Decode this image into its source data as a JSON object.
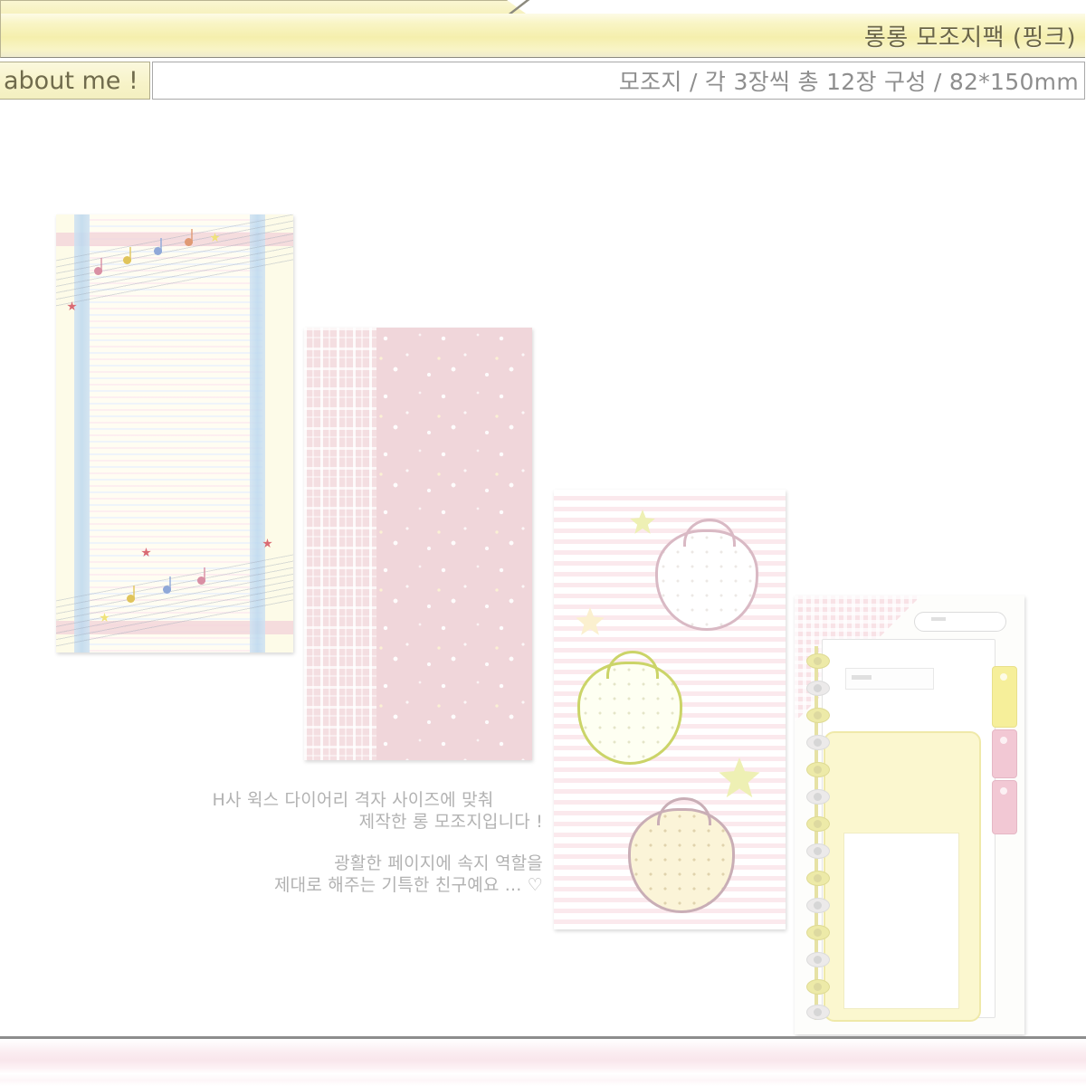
{
  "header": {
    "tab_label": "",
    "product_title": "롱롱 모조지팩 (핑크)",
    "about_label": "about me !",
    "spec_text": "모조지 / 각 3장씩 총 12장 구성 / 82*150mm"
  },
  "gallery": {
    "photos": [
      {
        "name": "music-note-lined-paper",
        "description": "크림색 줄지 + 하늘색 세로줄 + 음표 장식"
      },
      {
        "name": "pink-dotted-plaid-paper",
        "description": "핑크 도트 + 좌측 체크 무늬"
      },
      {
        "name": "strawberry-star-paper",
        "description": "핑크 가로줄 + 딸기 3개 + 별 3개"
      },
      {
        "name": "disc-bound-planner",
        "description": "디스크 바인더 다이어리 + 인덱스 탭"
      }
    ]
  },
  "caption": {
    "block1_line1": "H사 윅스 다이어리 격자 사이즈에 맞춰",
    "block1_line2": "제작한 롱 모조지입니다 !",
    "block2_line1": "광활한 페이지에 속지 역할을",
    "block2_line2": "제대로 해주는 기특한 친구예요 ... ♡"
  },
  "colors": {
    "header_yellow": "#f5efad",
    "header_text": "#6a6547",
    "spec_text": "#8e8e8e",
    "caption_text": "#b2b2b2",
    "footer_pink": "#f9e6ec",
    "rule_gray": "#8d8d8d"
  }
}
